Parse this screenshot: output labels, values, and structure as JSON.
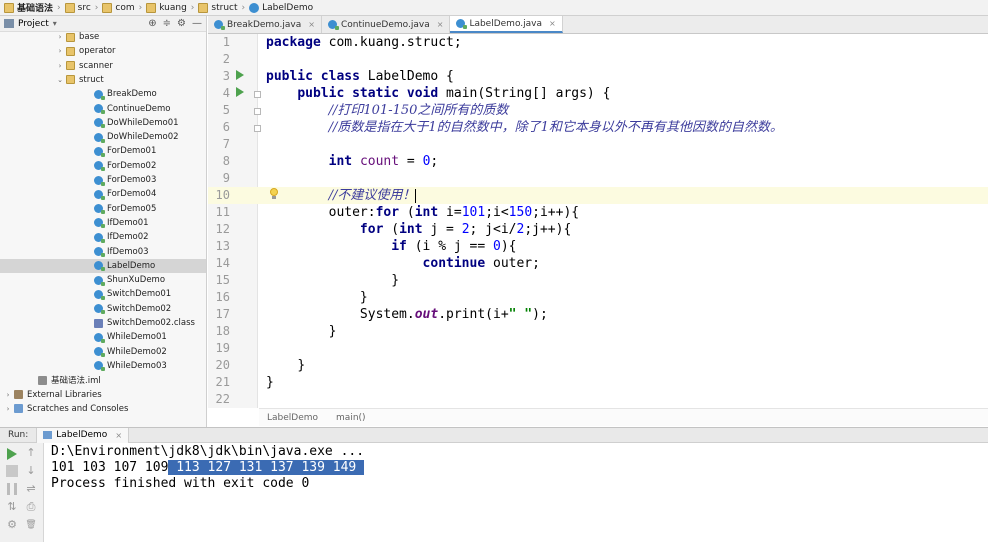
{
  "navbar": {
    "crumbs": [
      "基础语法",
      "src",
      "com",
      "kuang",
      "struct",
      "LabelDemo"
    ]
  },
  "project": {
    "title": "Project",
    "tools": [
      "⊕",
      "≑",
      "⚙",
      "—"
    ],
    "tree": [
      {
        "label": "base",
        "kind": "folder",
        "arrow": "›"
      },
      {
        "label": "operator",
        "kind": "folder",
        "arrow": "›"
      },
      {
        "label": "scanner",
        "kind": "folder",
        "arrow": "›"
      },
      {
        "label": "struct",
        "kind": "folder",
        "arrow": "⌄"
      },
      {
        "label": "BreakDemo",
        "kind": "class"
      },
      {
        "label": "ContinueDemo",
        "kind": "class"
      },
      {
        "label": "DoWhileDemo01",
        "kind": "class"
      },
      {
        "label": "DoWhileDemo02",
        "kind": "class"
      },
      {
        "label": "ForDemo01",
        "kind": "class"
      },
      {
        "label": "ForDemo02",
        "kind": "class"
      },
      {
        "label": "ForDemo03",
        "kind": "class"
      },
      {
        "label": "ForDemo04",
        "kind": "class"
      },
      {
        "label": "ForDemo05",
        "kind": "class"
      },
      {
        "label": "IfDemo01",
        "kind": "class"
      },
      {
        "label": "IfDemo02",
        "kind": "class"
      },
      {
        "label": "IfDemo03",
        "kind": "class"
      },
      {
        "label": "LabelDemo",
        "kind": "class",
        "selected": true
      },
      {
        "label": "ShunXuDemo",
        "kind": "class"
      },
      {
        "label": "SwitchDemo01",
        "kind": "class"
      },
      {
        "label": "SwitchDemo02",
        "kind": "class"
      },
      {
        "label": "SwitchDemo02.class",
        "kind": "classfile"
      },
      {
        "label": "WhileDemo01",
        "kind": "class"
      },
      {
        "label": "WhileDemo02",
        "kind": "class"
      },
      {
        "label": "WhileDemo03",
        "kind": "class"
      },
      {
        "label": "基础语法.iml",
        "kind": "iml"
      },
      {
        "label": "External Libraries",
        "kind": "lib",
        "arrow": "›"
      },
      {
        "label": "Scratches and Consoles",
        "kind": "scratch",
        "arrow": "›"
      }
    ]
  },
  "tabs": [
    {
      "label": "BreakDemo.java",
      "close": "×"
    },
    {
      "label": "ContinueDemo.java",
      "close": "×"
    },
    {
      "label": "LabelDemo.java",
      "close": "×",
      "active": true
    }
  ],
  "editor": {
    "line_numbers": [
      "1",
      "2",
      "3",
      "4",
      "5",
      "6",
      "7",
      "8",
      "9",
      "10",
      "11",
      "12",
      "13",
      "14",
      "15",
      "16",
      "17",
      "18",
      "19",
      "20",
      "21",
      "22"
    ],
    "code": {
      "l1_kw": "package",
      "l1_rest": " com.kuang.struct;",
      "l3_kw1": "public",
      "l3_kw2": "class",
      "l3_rest": " LabelDemo {",
      "l4_kw1": "public",
      "l4_kw2": "static",
      "l4_kw3": "void",
      "l4_rest": " main(String[] args) {",
      "l5_cmt": "//打印101-150之间所有的质数",
      "l6_cmt": "//质数是指在大于1的自然数中，除了1和它本身以外不再有其他因数的自然数。",
      "l8_kw": "int",
      "l8_var": "count",
      "l8_eq": " = ",
      "l8_num": "0",
      "l8_end": ";",
      "l10_cmt": "//不建议使用！",
      "l11_a": "outer:",
      "l11_for": "for",
      "l11_b": " (",
      "l11_int": "int",
      "l11_c": " i=",
      "l11_n1": "101",
      "l11_d": ";i<",
      "l11_n2": "150",
      "l11_e": ";i++){",
      "l12_for": "for",
      "l12_b": " (",
      "l12_int": "int",
      "l12_c": " j = ",
      "l12_n": "2",
      "l12_d": "; j<i/",
      "l12_n2": "2",
      "l12_e": ";j++){",
      "l13_if": "if",
      "l13_b": " (i % j == ",
      "l13_n": "0",
      "l13_c": "){",
      "l14_kw": "continue",
      "l14_rest": " outer;",
      "l15": "}",
      "l16": "}",
      "l17_a": "System.",
      "l17_out": "out",
      "l17_b": ".print(i+",
      "l17_str": "\" \"",
      "l17_c": ");",
      "l18": "}",
      "l20": "}",
      "l21": "}"
    },
    "breadcrumb": [
      "LabelDemo",
      "main()"
    ]
  },
  "run": {
    "label": "Run:",
    "tab": "LabelDemo",
    "tab_close": "×",
    "tool_up": "↑",
    "tool_down": "↓",
    "tool_wrap": "⇌",
    "tool_print": "⎙",
    "tool_del": "🗑",
    "command": "D:\\Environment\\jdk8\\jdk\\bin\\java.exe ...",
    "output_plain": "101 103 107 109",
    "output_selected": " 113 127 131 137 139 149 ",
    "finished": "Process finished with exit code 0"
  },
  "colors": {
    "keyword": "#000080",
    "number": "#0000ff",
    "comment": "#3c3c9c",
    "selection": "#3b6bb3",
    "run_green": "#4ea24e"
  }
}
